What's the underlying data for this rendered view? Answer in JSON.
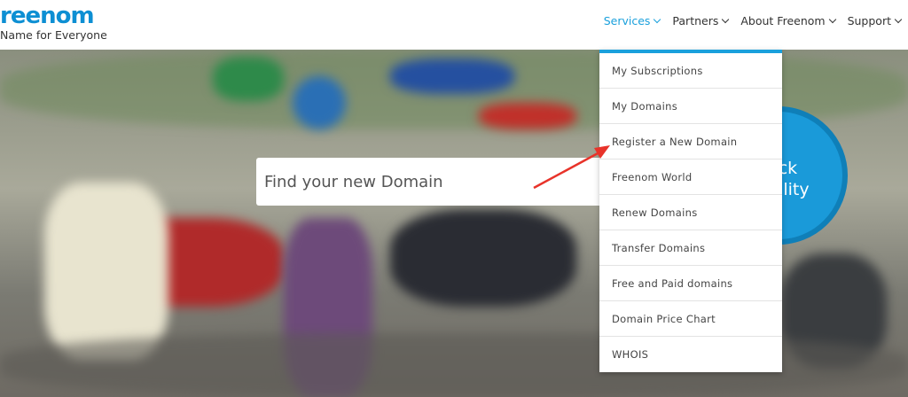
{
  "logo": {
    "word": "reenom",
    "tagline": "Name for Everyone"
  },
  "nav": [
    {
      "label": "Services",
      "active": true
    },
    {
      "label": "Partners",
      "active": false
    },
    {
      "label": "About Freenom",
      "active": false
    },
    {
      "label": "Support",
      "active": false
    }
  ],
  "search": {
    "placeholder": "Find your new Domain"
  },
  "check_button": {
    "line1": "eck",
    "line2": "bility"
  },
  "services_menu": [
    "My Subscriptions",
    "My Domains",
    "Register a New Domain",
    "Freenom World",
    "Renew Domains",
    "Transfer Domains",
    "Free and Paid domains",
    "Domain Price Chart",
    "WHOIS"
  ],
  "colors": {
    "accent": "#1aa0dc",
    "brand": "#0d8fd3",
    "annotation_arrow": "#e8332a"
  }
}
